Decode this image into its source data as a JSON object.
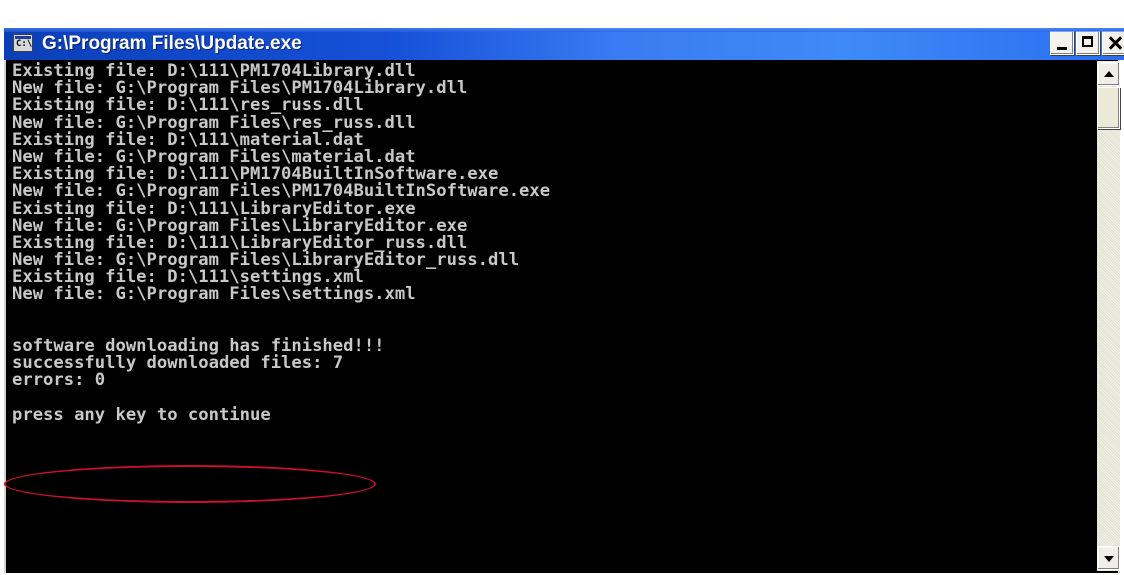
{
  "window": {
    "title": "G:\\Program Files\\Update.exe",
    "icon": "command-prompt-icon",
    "icon_text": "C:\\"
  },
  "console": {
    "lines": [
      "Existing file: D:\\111\\PM1704Library.dll",
      "New file: G:\\Program Files\\PM1704Library.dll",
      "Existing file: D:\\111\\res_russ.dll",
      "New file: G:\\Program Files\\res_russ.dll",
      "Existing file: D:\\111\\material.dat",
      "New file: G:\\Program Files\\material.dat",
      "Existing file: D:\\111\\PM1704BuiltInSoftware.exe",
      "New file: G:\\Program Files\\PM1704BuiltInSoftware.exe",
      "Existing file: D:\\111\\LibraryEditor.exe",
      "New file: G:\\Program Files\\LibraryEditor.exe",
      "Existing file: D:\\111\\LibraryEditor_russ.dll",
      "New file: G:\\Program Files\\LibraryEditor_russ.dll",
      "Existing file: D:\\111\\settings.xml",
      "New file: G:\\Program Files\\settings.xml",
      "",
      "",
      "software downloading has finished!!!",
      "successfully downloaded files: 7",
      "errors: 0",
      "",
      "press any key to continue"
    ],
    "text_color": "#c8c8c8",
    "background": "#000000"
  },
  "annotation": {
    "color": "#c8102e",
    "shape": "ellipse",
    "target": "press any key to continue"
  },
  "controls": {
    "minimize": "minimize-icon",
    "maximize": "maximize-icon",
    "close": "close-icon"
  }
}
